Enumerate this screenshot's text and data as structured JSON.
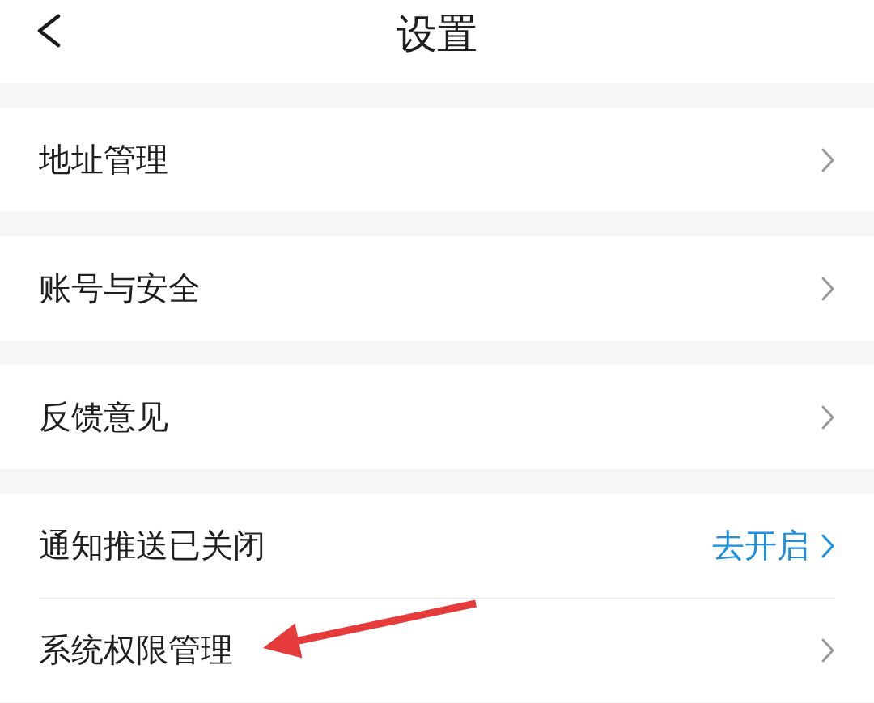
{
  "header": {
    "title": "设置"
  },
  "groups": [
    {
      "rows": [
        {
          "kind": "plain",
          "label": "地址管理",
          "marked_by_arrow": false
        }
      ]
    },
    {
      "rows": [
        {
          "kind": "plain",
          "label": "账号与安全",
          "marked_by_arrow": false
        }
      ]
    },
    {
      "rows": [
        {
          "kind": "plain",
          "label": "反馈意见",
          "marked_by_arrow": false
        }
      ]
    },
    {
      "rows": [
        {
          "kind": "action",
          "label": "通知推送已关闭",
          "action": "去开启",
          "marked_by_arrow": false
        },
        {
          "kind": "plain",
          "label": "系统权限管理",
          "marked_by_arrow": true
        }
      ]
    }
  ]
}
